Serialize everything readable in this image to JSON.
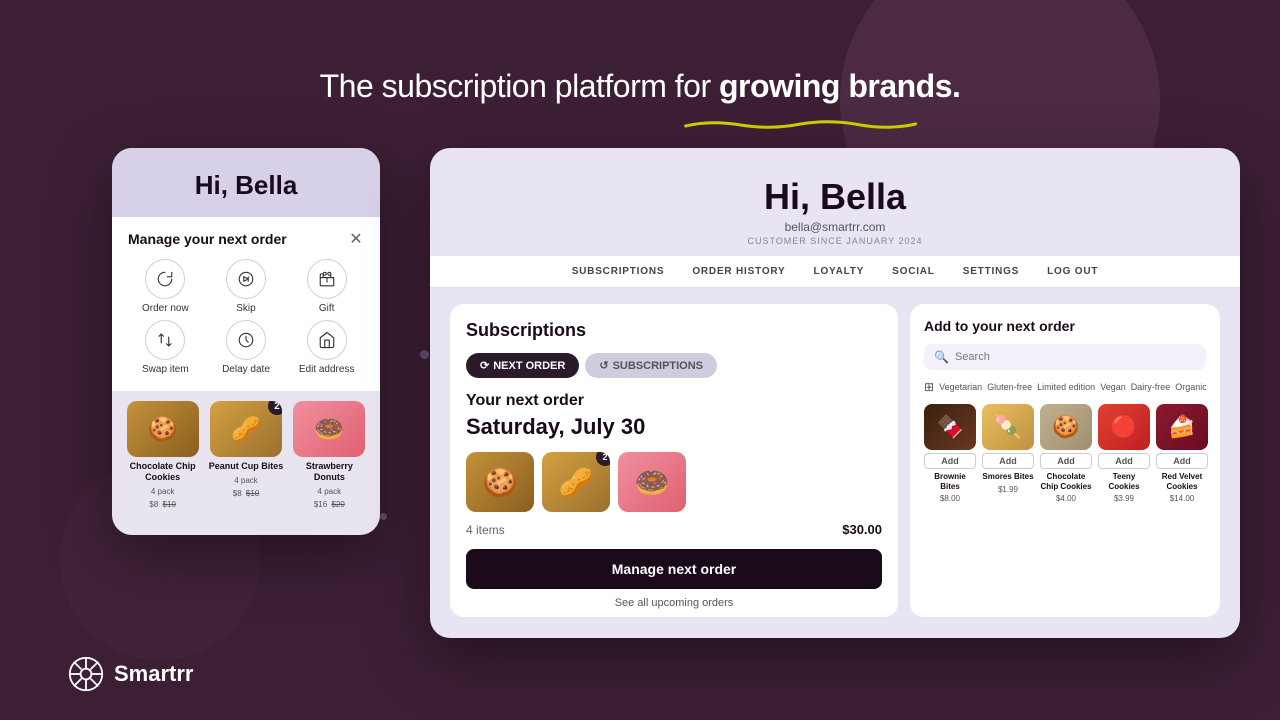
{
  "hero": {
    "text_pre": "The subscription platform for ",
    "text_bold": "growing brands.",
    "underline": true
  },
  "mobile_card": {
    "greeting": "Hi, Bella",
    "dialog_title": "Manage your next order",
    "actions": [
      {
        "label": "Order now",
        "icon": "refresh"
      },
      {
        "label": "Skip",
        "icon": "skip"
      },
      {
        "label": "Gift",
        "icon": "gift"
      },
      {
        "label": "Swap item",
        "icon": "swap"
      },
      {
        "label": "Delay date",
        "icon": "clock"
      },
      {
        "label": "Edit address",
        "icon": "home"
      }
    ],
    "products": [
      {
        "name": "Chocolate Chip Cookies",
        "pack": "4 pack",
        "price": "$8",
        "old_price": "$10",
        "badge": null,
        "emoji": "🍪"
      },
      {
        "name": "Peanut Cup Bites",
        "pack": "4 pack",
        "price": "$8",
        "old_price": "$10",
        "badge": "2",
        "emoji": "🥜"
      },
      {
        "name": "Strawberry Donuts",
        "pack": "4 pack",
        "price": "$16",
        "old_price": "$20",
        "badge": null,
        "emoji": "🍩"
      }
    ]
  },
  "desktop": {
    "greeting": "Hi, Bella",
    "email": "bella@smartrr.com",
    "since": "CUSTOMER SINCE JANUARY 2024",
    "nav": [
      "SUBSCRIPTIONS",
      "ORDER HISTORY",
      "LOYALTY",
      "SOCIAL",
      "SETTINGS",
      "LOG OUT"
    ],
    "section_title": "Subscriptions",
    "tabs": [
      {
        "label": "NEXT ORDER",
        "active": true
      },
      {
        "label": "SUBSCRIPTIONS",
        "active": false
      }
    ],
    "next_order": {
      "title": "Your next order",
      "date": "Saturday, July 30",
      "items_count": "4 items",
      "total": "$30.00",
      "manage_btn": "Manage next order",
      "see_all": "See all upcoming orders",
      "items": [
        {
          "emoji": "🍪",
          "badge": null
        },
        {
          "emoji": "🥜",
          "badge": "2"
        },
        {
          "emoji": "🍩",
          "badge": null
        }
      ]
    },
    "add_panel": {
      "title": "Add to your next order",
      "search_placeholder": "Search",
      "filters": [
        "Vegetarian",
        "Gluten-free",
        "Limited edition",
        "Vegan",
        "Dairy-free",
        "Organic"
      ],
      "products": [
        {
          "name": "Brownie Bites",
          "price": "$8.00",
          "emoji": "🍫"
        },
        {
          "name": "Smores Bites",
          "price": "$1.99",
          "emoji": "🍡"
        },
        {
          "name": "Chocolate Chip Cookies",
          "price": "$4.00",
          "emoji": "🍪"
        },
        {
          "name": "Teeny Cookies",
          "price": "$3.99",
          "emoji": "🔴"
        },
        {
          "name": "Red Velvet Cookies",
          "price": "$14.00",
          "emoji": "🍰"
        }
      ],
      "add_label": "Add"
    }
  },
  "logo": {
    "name": "Smartrr"
  }
}
